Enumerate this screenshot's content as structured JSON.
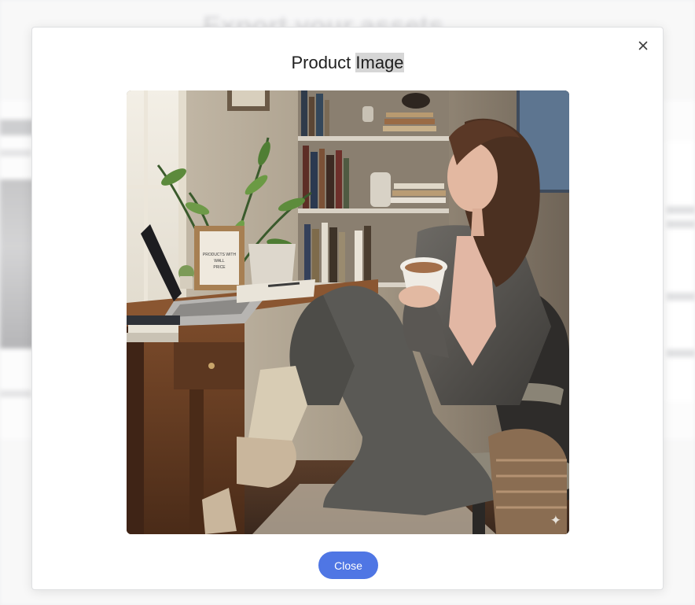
{
  "background": {
    "title": "Export your assets"
  },
  "modal": {
    "title_part1": "Product ",
    "title_part2": "Image",
    "close_label": "Close",
    "image_alt": "Woman in a grey blazer sitting in an office chair holding a cup of coffee beside a desk with a laptop, plant and bookshelf",
    "frame_text": "PRODUCTS WITH WALL PRICE",
    "sparkle_icon": "sparkle-icon"
  },
  "colors": {
    "accent": "#4f76e4",
    "title_highlight": "#d6d6d6"
  }
}
